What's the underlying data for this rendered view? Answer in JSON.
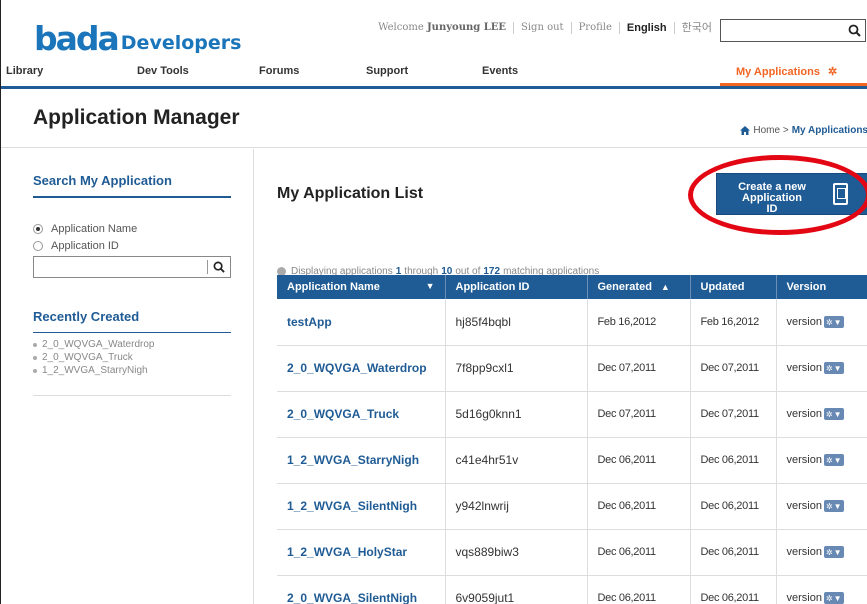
{
  "header": {
    "logo_bada": "bada",
    "logo_dev": "Developers",
    "welcome_prefix": "Welcome",
    "welcome_user": "Junyoung LEE",
    "sign_out": "Sign out",
    "profile": "Profile",
    "english": "English",
    "korean": "한국어",
    "search_value": ""
  },
  "nav": {
    "items": [
      "Library",
      "Dev Tools",
      "Forums",
      "Support",
      "Events"
    ],
    "my_applications": "My Applications",
    "my_applications_icon": "gear-icon"
  },
  "title": {
    "page_title": "Application Manager",
    "crumb_home": "Home",
    "crumb_sep": ">",
    "crumb_current": "My Applications"
  },
  "sidebar": {
    "search_title": "Search My Application",
    "radio_name": "Application Name",
    "radio_id": "Application ID",
    "search_value": "",
    "recent_title": "Recently Created",
    "recent_items": [
      "2_0_WQVGA_Waterdrop",
      "2_0_WQVGA_Truck",
      "1_2_WVGA_StarryNigh"
    ]
  },
  "main": {
    "list_title": "My Application List",
    "create_line1": "Create a new",
    "create_line2": "Application ID",
    "info_prefix": "Displaying applications",
    "info_from": "1",
    "info_through": "through",
    "info_to": "10",
    "info_outof": "out of",
    "info_total": "172",
    "info_suffix": "matching applications",
    "columns": [
      "Application Name",
      "Application ID",
      "Generated",
      "Updated",
      "Version"
    ],
    "rows": [
      {
        "name": "testApp",
        "id": "hj85f4bqbl",
        "generated": "Feb 16,2012",
        "updated": "Feb 16,2012",
        "version": "version"
      },
      {
        "name": "2_0_WQVGA_Waterdrop",
        "id": "7f8pp9cxl1",
        "generated": "Dec 07,2011",
        "updated": "Dec 07,2011",
        "version": "version"
      },
      {
        "name": "2_0_WQVGA_Truck",
        "id": "5d16g0knn1",
        "generated": "Dec 07,2011",
        "updated": "Dec 07,2011",
        "version": "version"
      },
      {
        "name": "1_2_WVGA_StarryNigh",
        "id": "c41e4hr51v",
        "generated": "Dec 06,2011",
        "updated": "Dec 06,2011",
        "version": "version"
      },
      {
        "name": "1_2_WVGA_SilentNigh",
        "id": "y942lnwrij",
        "generated": "Dec 06,2011",
        "updated": "Dec 06,2011",
        "version": "version"
      },
      {
        "name": "1_2_WVGA_HolyStar",
        "id": "vqs889biw3",
        "generated": "Dec 06,2011",
        "updated": "Dec 06,2011",
        "version": "version"
      },
      {
        "name": "2_0_WVGA_SilentNigh",
        "id": "6v9059jut1",
        "generated": "Dec 06,2011",
        "updated": "Dec 06,2011",
        "version": "version"
      }
    ]
  },
  "colors": {
    "brand_blue": "#1f5b94",
    "accent_orange": "#f26522",
    "highlight_red": "#e30613"
  }
}
